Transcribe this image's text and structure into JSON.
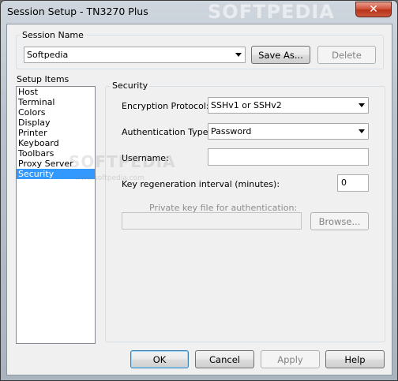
{
  "window": {
    "title": "Session Setup - TN3270 Plus",
    "watermark": "SOFTPEDIA",
    "close_glyph": "✕"
  },
  "session_name": {
    "group_label": "Session Name",
    "value": "Softpedia",
    "save_as_label": "Save As...",
    "delete_label": "Delete"
  },
  "setup_items": {
    "label": "Setup Items",
    "items": [
      "Host",
      "Terminal",
      "Colors",
      "Display",
      "Printer",
      "Keyboard",
      "Toolbars",
      "Proxy Server",
      "Security"
    ],
    "selected": "Security"
  },
  "security": {
    "group_label": "Security",
    "encryption_label": "Encryption Protocol:",
    "encryption_value": "SSHv1 or SSHv2",
    "auth_label": "Authentication Type:",
    "auth_value": "Password",
    "username_label": "Username:",
    "username_value": "",
    "key_regen_label": "Key regeneration interval (minutes):",
    "key_regen_value": "0",
    "private_key_label": "Private key file for authentication:",
    "private_key_value": "",
    "browse_label": "Browse..."
  },
  "buttons": {
    "ok": "OK",
    "cancel": "Cancel",
    "apply": "Apply",
    "help": "Help"
  },
  "watermark_center": {
    "big": "SOFTPEDIA",
    "small": "www.softpedia.com"
  }
}
